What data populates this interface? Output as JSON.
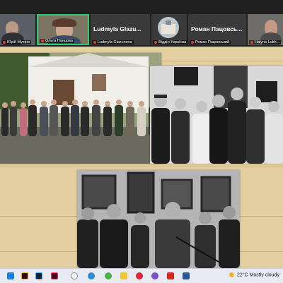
{
  "participants": [
    {
      "name": "Юрій Мухіно",
      "type": "video"
    },
    {
      "name": "Ольга Панцова",
      "type": "video",
      "active": true
    },
    {
      "name": "Ludmyla Glazunova",
      "display_name": "Ludmyla Glazu...",
      "type": "name"
    },
    {
      "name": "Відділ Українка",
      "type": "avatar"
    },
    {
      "name": "Роман Пацовський",
      "display_name": "Роман Пацовсь...",
      "type": "name"
    },
    {
      "name": "Halyna Lukh...",
      "type": "video"
    }
  ],
  "shared_screen": {
    "photos": [
      {
        "label": "group-photo-outdoor"
      },
      {
        "label": "group-photo-museum-entrance"
      },
      {
        "label": "museum-interior-photo"
      }
    ]
  },
  "taskbar": {
    "apps": [
      "windows-start",
      "illustrator",
      "photoshop",
      "indesign",
      "search",
      "edge",
      "chrome",
      "files",
      "opera",
      "viber",
      "acrobat",
      "word"
    ],
    "weather_temp": "22°C",
    "weather_text": "Mostly cloudy"
  },
  "colors": {
    "strip_bg": "#202020",
    "active_border": "#2ecc71",
    "background": "#e3cfa0",
    "taskbar_bg": "#e8ecf2"
  }
}
